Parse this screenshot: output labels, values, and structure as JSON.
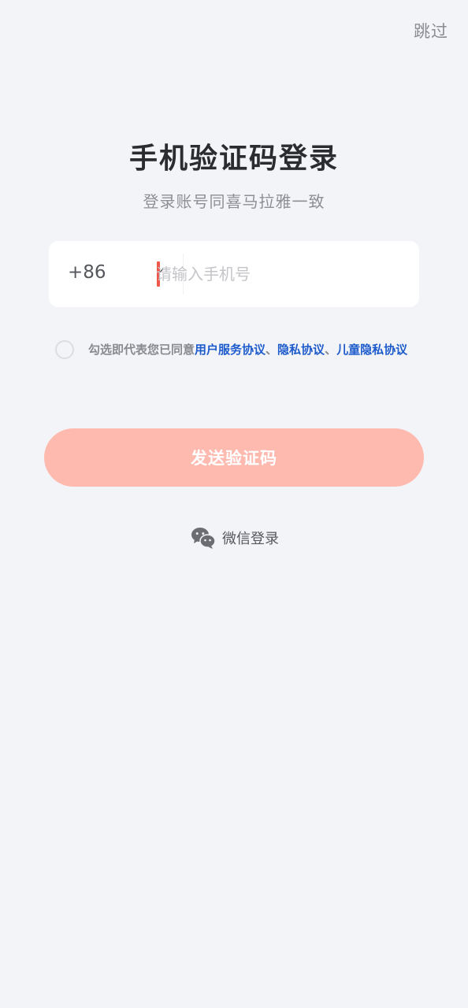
{
  "header": {
    "skip_label": "跳过"
  },
  "main": {
    "title": "手机验证码登录",
    "subtitle": "登录账号同喜马拉雅一致"
  },
  "phone": {
    "country_code": "+86",
    "placeholder": "请输入手机号",
    "value": ""
  },
  "agreement": {
    "prefix": "勾选即代表您已同意",
    "user_service": "用户服务协议",
    "sep1": "、",
    "privacy": "隐私协议",
    "sep2": "、",
    "child_privacy": "儿童隐私协议",
    "checked": false
  },
  "actions": {
    "send_code_label": "发送验证码",
    "wechat_login_label": "微信登录"
  },
  "colors": {
    "background": "#f3f4f8",
    "primary_disabled": "#ffbab0",
    "link": "#1e5ccc",
    "caret": "#f0574a"
  },
  "icons": {
    "chevron": "chevron-down-icon",
    "wechat": "wechat-icon",
    "checkbox": "radio-circle-icon"
  }
}
